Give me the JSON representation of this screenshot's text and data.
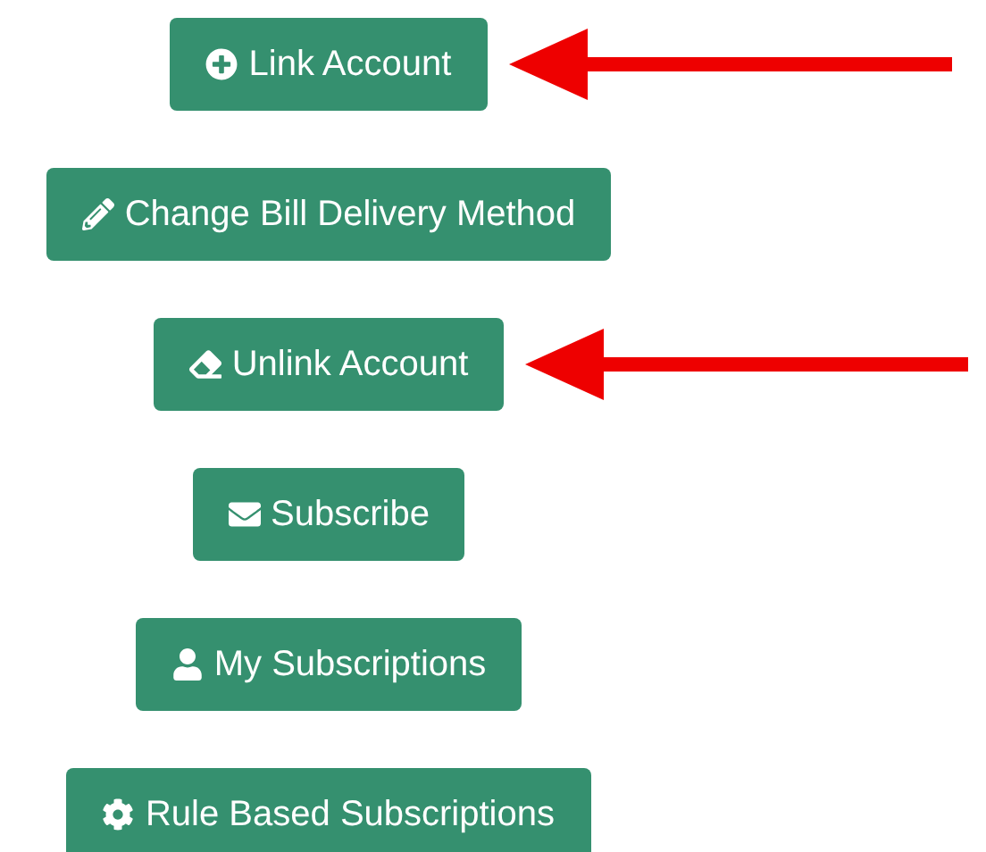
{
  "buttons": [
    {
      "kind": "link",
      "label": "Link Account",
      "annotated": true
    },
    {
      "kind": "edit",
      "label": "Change Bill Delivery Method",
      "annotated": false
    },
    {
      "kind": "unlink",
      "label": "Unlink Account",
      "annotated": true
    },
    {
      "kind": "subscribe",
      "label": "Subscribe",
      "annotated": false
    },
    {
      "kind": "subscriptions",
      "label": "My Subscriptions",
      "annotated": false
    },
    {
      "kind": "rules",
      "label": "Rule Based Subscriptions",
      "annotated": false
    }
  ]
}
